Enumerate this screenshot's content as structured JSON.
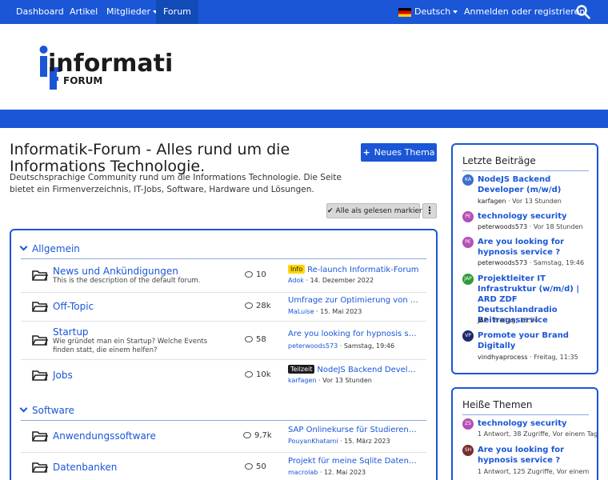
{
  "nav": {
    "items": [
      "Dashboard",
      "Artikel",
      "Mitglieder",
      "Forum"
    ],
    "language": "Deutsch",
    "login": "Anmelden oder registrieren"
  },
  "logo": {
    "text": "informatik",
    "sub": "FORUM"
  },
  "page": {
    "title": "Informatik-Forum - Alles rund um die Informations Technologie.",
    "description": "Deutschsprachige Community rund um die Informations Technologie. Die Seite bietet ein Firmenverzeichnis, IT-Jobs, Software, Hardware und Lösungen.",
    "new_thread": "Neues Thema",
    "mark_read": "Alle als gelesen markieren"
  },
  "categories": [
    {
      "name": "Allgemein",
      "forums": [
        {
          "title": "News und Ankündigungen",
          "desc": "This is the description of the default forum.",
          "count": "10",
          "tag": "Info",
          "last": "Re-launch Informatik-Forum",
          "user": "Adok",
          "time": "14. Dezember 2022"
        },
        {
          "title": "Off-Topic",
          "desc": "",
          "count": "28k",
          "tag": "",
          "last": "Umfrage zur Optimierung von Ste…",
          "user": "MaLuise",
          "time": "15. Mai 2023"
        },
        {
          "title": "Startup",
          "desc": "Wie gründet man ein Startup? Welche Events finden statt, die einem helfen?",
          "count": "58",
          "tag": "",
          "last": "Are you looking for hypnosis servi…",
          "user": "peterwoods573",
          "time": "Samstag, 19:46"
        },
        {
          "title": "Jobs",
          "desc": "",
          "count": "10k",
          "tag": "Teilzeit",
          "last": "NodeJS Backend Develop…",
          "user": "karfagen",
          "time": "Vor 13 Stunden"
        }
      ]
    },
    {
      "name": "Software",
      "forums": [
        {
          "title": "Anwendungssoftware",
          "desc": "",
          "count": "9,7k",
          "tag": "",
          "last": "SAP Onlinekurse für Studierende i…",
          "user": "PouyanKhatami",
          "time": "15. März 2023"
        },
        {
          "title": "Datenbanken",
          "desc": "",
          "count": "50",
          "tag": "",
          "last": "Projekt für meine Sqlite Datenbank",
          "user": "macrolab",
          "time": "12. Mai 2023"
        }
      ]
    }
  ],
  "latest": {
    "title": "Letzte Beiträge",
    "items": [
      {
        "avatar": "KA",
        "color": "#3b6fd0",
        "title": "NodeJS Backend Developer (m/w/d)",
        "user": "karfagen",
        "time": "Vor 13 Stunden"
      },
      {
        "avatar": "PE",
        "color": "#b44fb8",
        "title": "technology security",
        "user": "peterwoods573",
        "time": "Vor 18 Stunden"
      },
      {
        "avatar": "PE",
        "color": "#b44fb8",
        "title": "Are you looking for hypnosis service ?",
        "user": "peterwoods573",
        "time": "Samstag, 19:46"
      },
      {
        "avatar": "JAP",
        "color": "#2e9a3a",
        "title": "Projektleiter IT Infrastruktur (w/m/d) | ARD ZDF Deutschlandradio Beitragsservice",
        "user": "JAP",
        "time": "Freitag, 18:54"
      },
      {
        "avatar": "VP",
        "color": "#1b2a6b",
        "title": "Promote your Brand Digitally",
        "user": "vindhyaprocess",
        "time": "Freitag, 11:35"
      }
    ]
  },
  "hot": {
    "title": "Heiße Themen",
    "items": [
      {
        "avatar": "ZS",
        "color": "#b44fb8",
        "title": "technology security",
        "meta": "1 Antwort, 38 Zugriffe, Vor einem Tag"
      },
      {
        "avatar": "SH",
        "color": "#7a2d2d",
        "title": "Are you looking for hypnosis service ?",
        "meta": "1 Antwort, 125 Zugriffe, Vor einem"
      }
    ]
  },
  "colors": {
    "primary": "#1a56d6",
    "tag_info": "#ffd500",
    "tag_part": "#1b1b1b"
  }
}
